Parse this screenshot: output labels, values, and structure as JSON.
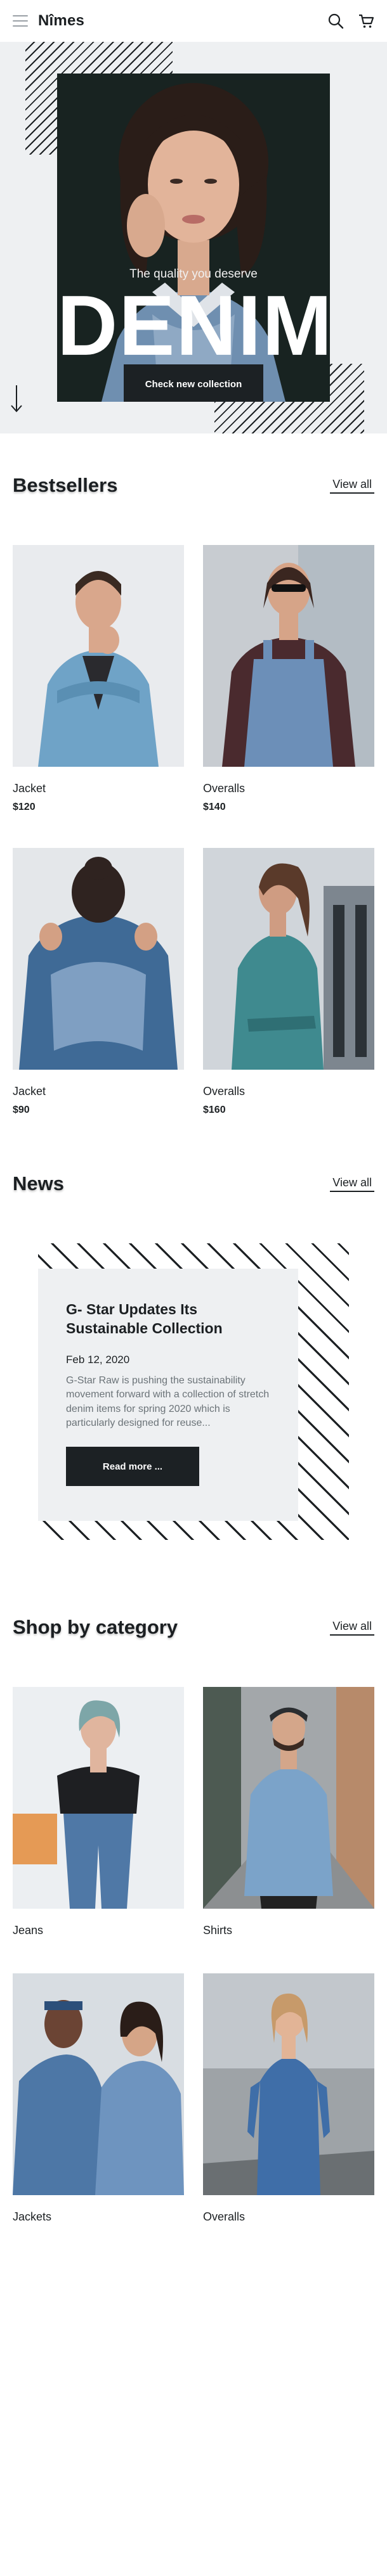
{
  "header": {
    "logo": "Nîmes",
    "icons": [
      "menu-icon",
      "search-icon",
      "cart-icon"
    ]
  },
  "hero": {
    "tagline": "The quality you deserve",
    "title": "DENIM",
    "cta_label": "Check new collection"
  },
  "bestsellers": {
    "title": "Bestsellers",
    "view_all": "View all",
    "items": [
      {
        "name": "Jacket",
        "price": "$120"
      },
      {
        "name": "Overalls",
        "price": "$140"
      },
      {
        "name": "Jacket",
        "price": "$90"
      },
      {
        "name": "Overalls",
        "price": "$160"
      }
    ]
  },
  "news": {
    "title": "News",
    "view_all": "View all",
    "article": {
      "title": "G- Star Updates Its Sustainable Collection",
      "date": "Feb 12, 2020",
      "excerpt": "G-Star Raw is pushing the sustainability movement forward with a collection of stretch denim items for spring 2020 which is particularly designed for reuse...",
      "button": "Read more ..."
    }
  },
  "categories": {
    "title": "Shop by category",
    "view_all": "View all",
    "items": [
      {
        "name": "Jeans"
      },
      {
        "name": "Shirts"
      },
      {
        "name": "Jackets"
      },
      {
        "name": "Overalls"
      }
    ]
  },
  "colors": {
    "dark": "#1c2124",
    "light_gray": "#eef0f2",
    "muted_text": "#6b7378"
  }
}
